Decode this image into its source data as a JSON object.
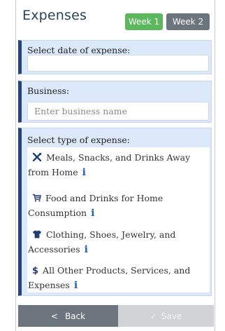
{
  "header": {
    "title": "Expenses",
    "week1_label": "Week 1",
    "week2_label": "Week 2",
    "week1_color": "#5cb85c",
    "week2_color": "#6c757d"
  },
  "date_section": {
    "label": "Select date of expense:",
    "value": ""
  },
  "business_section": {
    "label": "Business:",
    "placeholder": "Enter business name",
    "value": ""
  },
  "type_section": {
    "label": "Select type of expense:",
    "options": [
      {
        "icon": "utensils-icon",
        "glyph": "✕",
        "label": "Meals, Snacks, and Drinks Away from Home",
        "info": "i"
      },
      {
        "icon": "shopping-cart-icon",
        "glyph": "⨊",
        "label": "Food and Drinks for Home Consumption",
        "info": "i"
      },
      {
        "icon": "tshirt-icon",
        "glyph": "☰",
        "label": "Clothing, Shoes, Jewelry, and Accessories",
        "info": "i"
      },
      {
        "icon": "dollar-icon",
        "glyph": "$",
        "label": "All Other Products, Services, and Expenses",
        "info": "i"
      }
    ]
  },
  "footer": {
    "back_glyph": "<",
    "back_label": "Back",
    "save_glyph": "✓",
    "save_label": "Save"
  },
  "colors": {
    "section_bg": "#dbe9fa",
    "section_accent": "#24447a",
    "title": "#28435f"
  }
}
